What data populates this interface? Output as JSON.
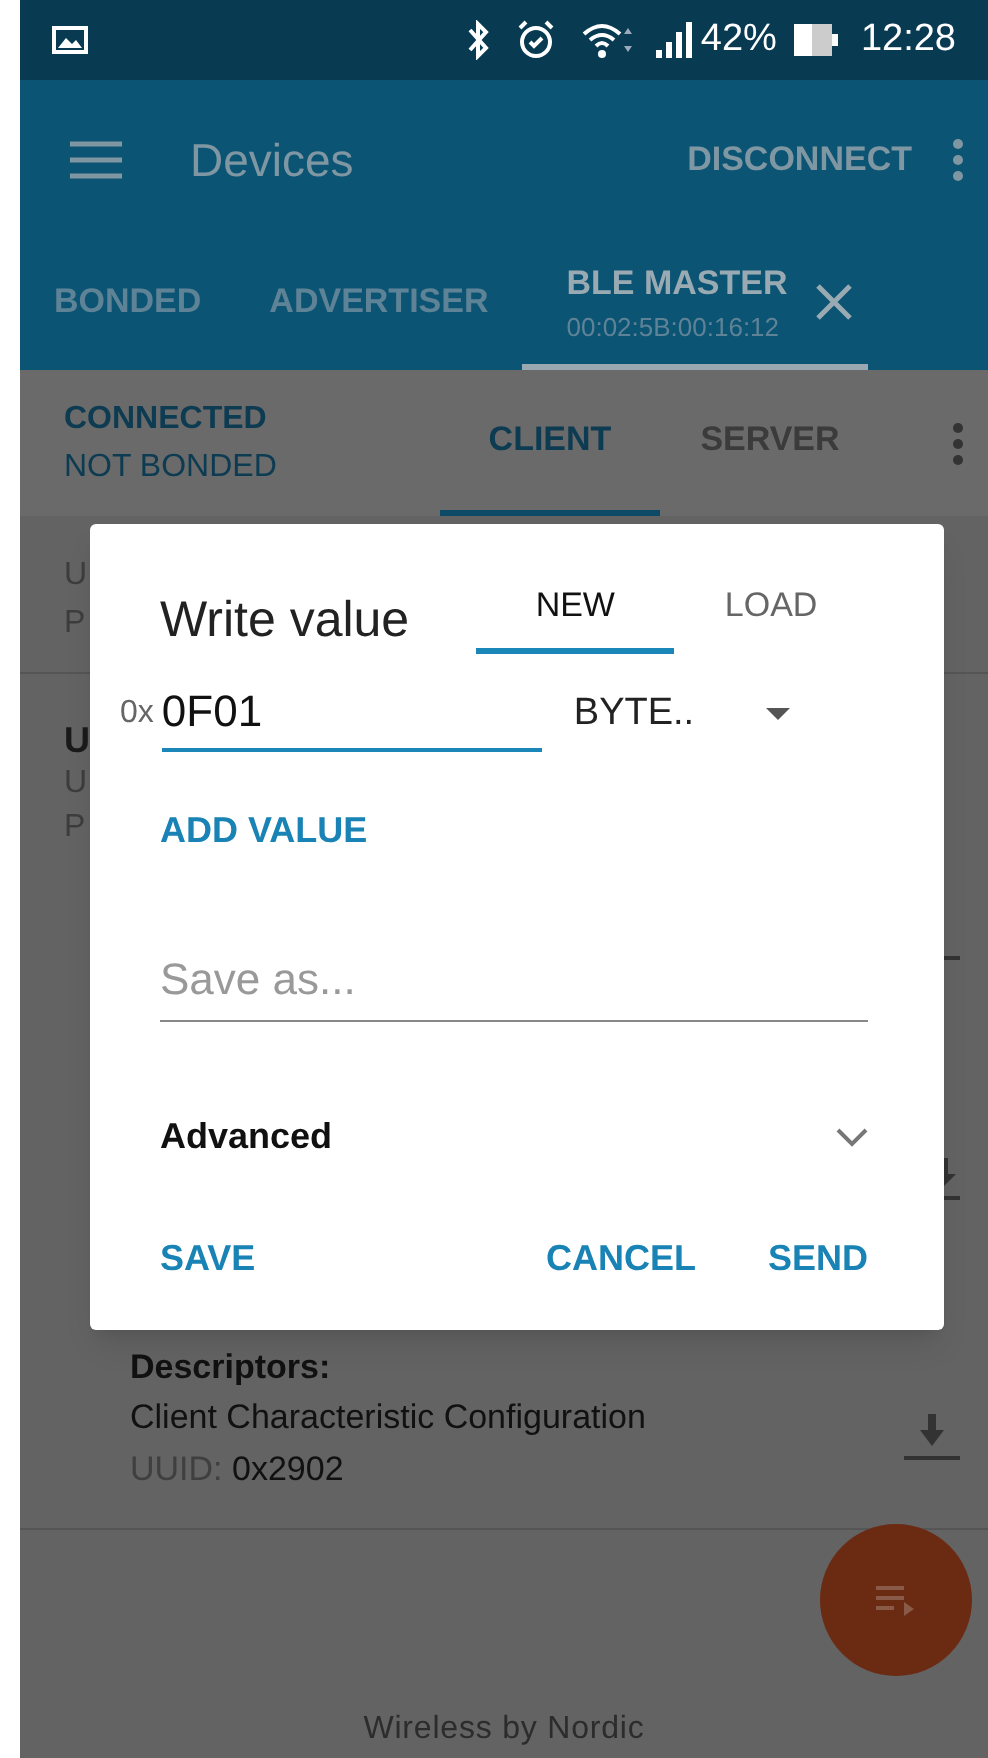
{
  "status_bar": {
    "battery": "42%",
    "time": "12:28"
  },
  "app_bar": {
    "title": "Devices",
    "action": "DISCONNECT"
  },
  "device_tabs": [
    {
      "label": "BONDED",
      "selected": false
    },
    {
      "label": "ADVERTISER",
      "selected": false
    },
    {
      "label": "BLE MASTER",
      "subtitle": "00:02:5B:00:16:12",
      "selected": true
    }
  ],
  "connection": {
    "state": "CONNECTED",
    "bond": "NOT BONDED"
  },
  "role_tabs": [
    {
      "label": "CLIENT",
      "selected": true
    },
    {
      "label": "SERVER",
      "selected": false
    }
  ],
  "background_rows": [
    {
      "lines": [
        "U",
        "P"
      ]
    },
    {
      "title": "U",
      "lines": [
        "U",
        "P"
      ]
    }
  ],
  "descriptor": {
    "heading": "Descriptors:",
    "name": "Client Characteristic Configuration",
    "uuid_label": "UUID:",
    "uuid": "0x2902"
  },
  "footer": "Wireless by Nordic",
  "dialog": {
    "title": "Write value",
    "tabs": [
      {
        "label": "NEW",
        "selected": true
      },
      {
        "label": "LOAD",
        "selected": false
      }
    ],
    "prefix": "0x",
    "value": "0F01",
    "format": "BYTE..",
    "add_value": "ADD VALUE",
    "save_as_placeholder": "Save as...",
    "advanced": {
      "label": "Advanced",
      "expanded": false
    },
    "buttons": [
      "SAVE",
      "CANCEL",
      "SEND"
    ]
  }
}
